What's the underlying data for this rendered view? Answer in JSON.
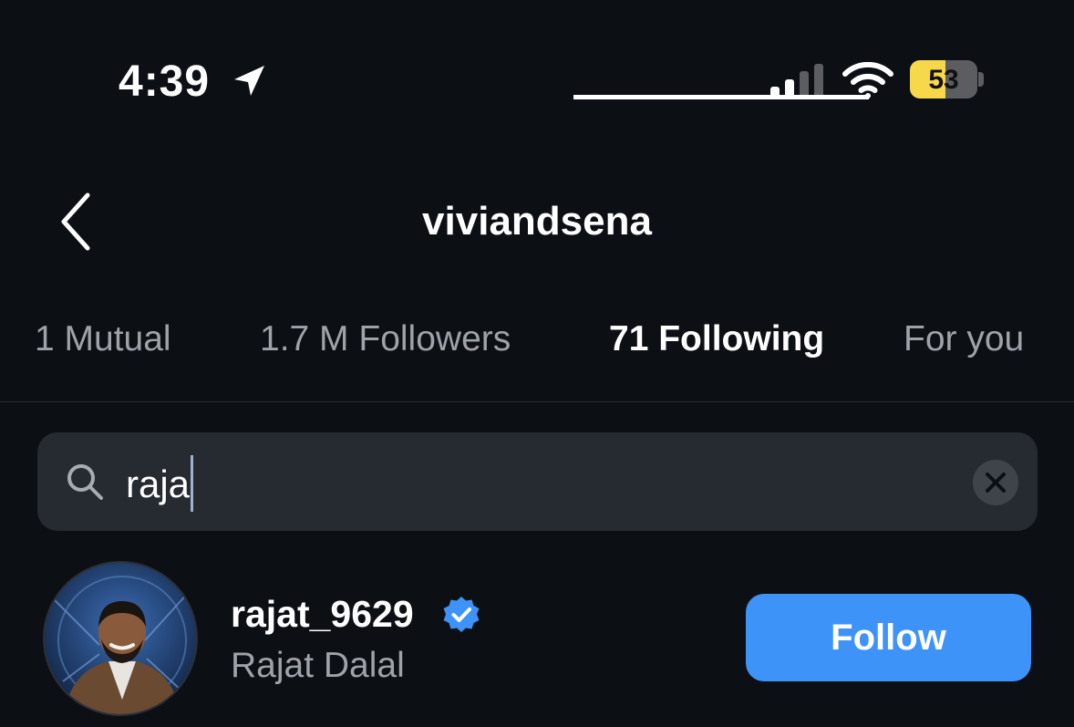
{
  "status_bar": {
    "time": "4:39",
    "battery_percent": "53",
    "battery_level": 0.53,
    "icons": [
      "location-arrow-icon",
      "cellular-signal-icon",
      "wifi-icon",
      "battery-icon"
    ]
  },
  "header": {
    "title": "viviandsena",
    "back_icon": "chevron-left-icon"
  },
  "tabs": [
    {
      "label": "1 Mutual",
      "active": false
    },
    {
      "label": "1.7 M Followers",
      "active": false
    },
    {
      "label": "71 Following",
      "active": true
    },
    {
      "label": "For you",
      "active": false
    }
  ],
  "search": {
    "value": "raja",
    "icon": "search-icon",
    "clear_icon": "clear-x-icon"
  },
  "results": [
    {
      "username": "rajat_9629",
      "full_name": "Rajat Dalal",
      "verified": true,
      "button_label": "Follow"
    }
  ],
  "colors": {
    "background": "#0c0f14",
    "search_background": "#262a31",
    "follow_button": "#3d93f7",
    "verified_badge": "#3d93f7",
    "battery_fill": "#f7d84a",
    "inactive_text": "#9ea3aa"
  }
}
